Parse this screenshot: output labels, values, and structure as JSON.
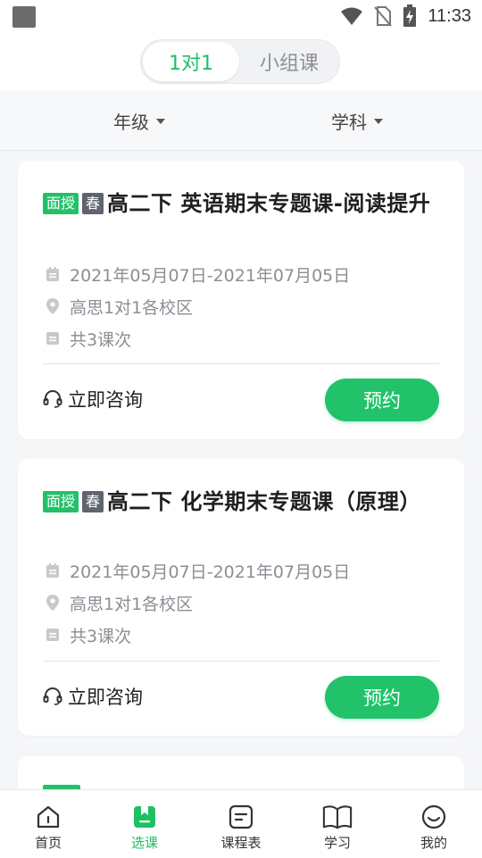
{
  "status_bar": {
    "time": "11:33"
  },
  "tabs": {
    "options": [
      "1对1",
      "小组课"
    ],
    "selected": "1对1"
  },
  "filters": {
    "grade_label": "年级",
    "subject_label": "学科"
  },
  "courses": [
    {
      "tag_mode": "面授",
      "tag_season": "春",
      "title": "高二下  英语期末专题课-阅读提升",
      "date_range": "2021年05月07日-2021年07月05日",
      "location": "高思1对1各校区",
      "sessions": "共3课次",
      "consult_label": "立即咨询",
      "book_label": "预约"
    },
    {
      "tag_mode": "面授",
      "tag_season": "春",
      "title": "高二下  化学期末专题课（原理）",
      "date_range": "2021年05月07日-2021年07月05日",
      "location": "高思1对1各校区",
      "sessions": "共3课次",
      "consult_label": "立即咨询",
      "book_label": "预约"
    }
  ],
  "bottom_nav": {
    "items": [
      {
        "label": "首页",
        "icon": "home-icon"
      },
      {
        "label": "选课",
        "icon": "select-course-icon"
      },
      {
        "label": "课程表",
        "icon": "schedule-icon"
      },
      {
        "label": "学习",
        "icon": "book-icon"
      },
      {
        "label": "我的",
        "icon": "profile-icon"
      }
    ],
    "active": "选课"
  },
  "colors": {
    "accent": "#22c26a",
    "tag_gray": "#5f6470",
    "background": "#f5f6f8"
  }
}
